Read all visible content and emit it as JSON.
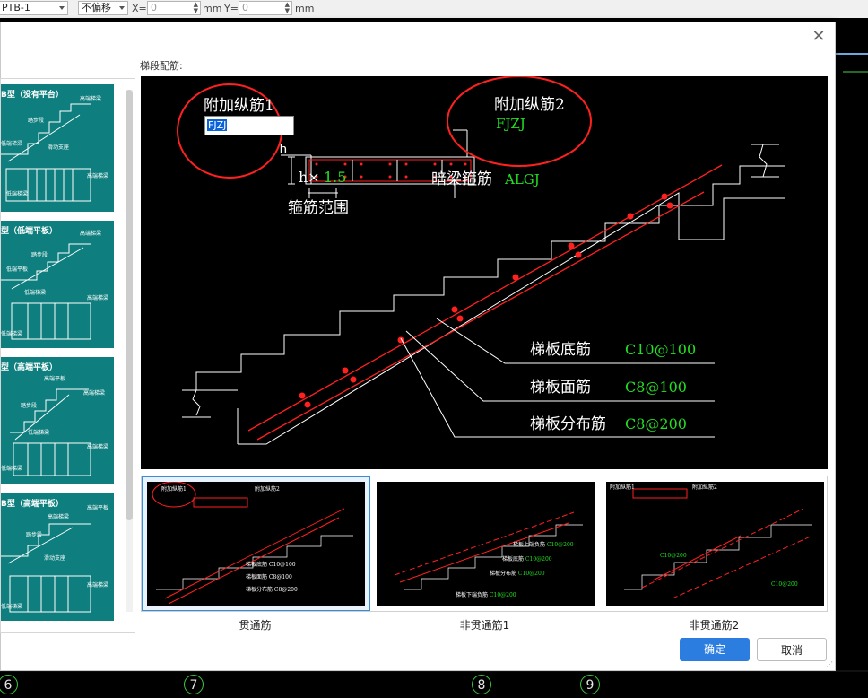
{
  "toolbar": {
    "component_value": "PTB-1",
    "offset_value": "不偏移",
    "x_label": "X=",
    "x_value": "0",
    "x_unit": "mm",
    "y_label": "Y=",
    "y_value": "0",
    "y_unit": "mm"
  },
  "axis_numbers": [
    "6",
    "7",
    "8",
    "9"
  ],
  "dialog": {
    "section_title": "梯段配筋:",
    "close_icon": "close-icon",
    "left_types": [
      {
        "title": "B型（没有平台）",
        "labels": [
          "高端梯梁",
          "踏步段",
          "低端梯梁",
          "滑动支座",
          "高端梯梁",
          "低端梯梁"
        ]
      },
      {
        "title": "型（低端平板）",
        "labels": [
          "高端梯梁",
          "踏步段",
          "低端平板",
          "低端梯梁",
          "高端梯梁",
          "低端梯梁"
        ]
      },
      {
        "title": "型（高端平板）",
        "labels": [
          "高端平板",
          "高端梯梁",
          "踏步段",
          "低端梯梁",
          "高端梯梁",
          "低端梯梁"
        ]
      },
      {
        "title": "B型（高端平板）",
        "labels": [
          "高端平板",
          "高端梯梁",
          "踏步段",
          "滑动支座",
          "高端梯梁",
          "低端梯梁"
        ]
      }
    ],
    "preview": {
      "extra_bar1_label": "附加纵筋1",
      "extra_bar1_input": "FJZJ",
      "h_label": "h",
      "h_mult": "h×",
      "h_mult_value": "1.5",
      "stirrup_range": "箍筋范围",
      "extra_bar2_label": "附加纵筋2",
      "extra_bar2_code": "FJZJ",
      "hidden_beam_stirrup": "暗梁箍筋",
      "hidden_beam_code": "ALGJ",
      "bottom_bar_label": "梯板底筋",
      "bottom_bar_value": "C10@100",
      "top_bar_label": "梯板面筋",
      "top_bar_value": "C8@100",
      "dist_bar_label": "梯板分布筋",
      "dist_bar_value": "C8@200"
    },
    "options": [
      {
        "label": "贯通筋",
        "selected": true
      },
      {
        "label": "非贯通筋1",
        "selected": false
      },
      {
        "label": "非贯通筋2",
        "selected": false
      }
    ],
    "option2_labels": [
      "梯板上端负筋",
      "C10@200",
      "梯板底筋",
      "C10@200",
      "梯板分布筋",
      "C10@200",
      "梯板下端负筋",
      "C10@200"
    ],
    "ok_label": "确定",
    "cancel_label": "取消"
  },
  "colors": {
    "accent": "#2b7de0",
    "cad_green": "#22e022",
    "cad_red": "#ff2020",
    "thumb_teal": "#0e7f7e"
  }
}
